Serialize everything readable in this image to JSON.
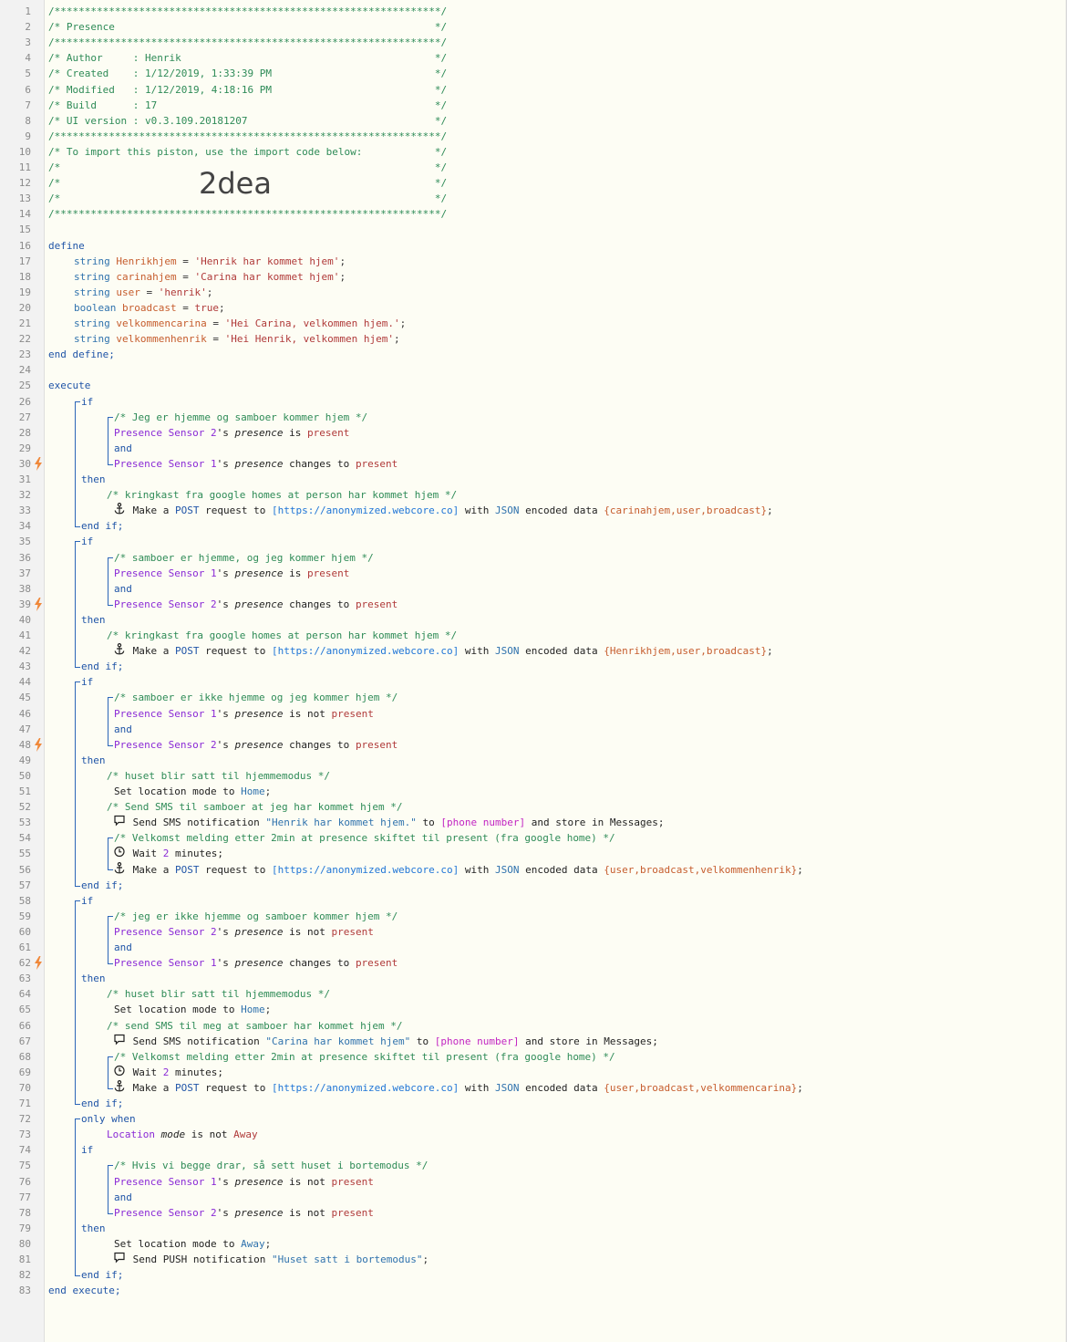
{
  "header_lines": [
    "/****************************************************************/",
    "/* Presence                                                     */",
    "/****************************************************************/",
    "/* Author     : Henrik                                          */",
    "/* Created    : 1/12/2019, 1:33:39 PM                           */",
    "/* Modified   : 1/12/2019, 4:18:16 PM                           */",
    "/* Build      : 17                                              */",
    "/* UI version : v0.3.109.20181207                               */",
    "/****************************************************************/",
    "/* To import this piston, use the import code below:            */",
    "/*                                                              */",
    "/*                                                              */",
    "/*                                                              */",
    "/****************************************************************/"
  ],
  "import_code": "2dea",
  "keywords": {
    "define": "define",
    "end_define": "end define;",
    "execute": "execute",
    "end_execute": "end execute;",
    "if": "if",
    "then": "then",
    "end_if": "end if;",
    "and": "and",
    "only_when": "only when"
  },
  "defines": [
    {
      "type": "string",
      "name": "Henrikhjem",
      "value": "'Henrik har kommet hjem'"
    },
    {
      "type": "string",
      "name": "carinahjem",
      "value": "'Carina har kommet hjem'"
    },
    {
      "type": "string",
      "name": "user",
      "value": "'henrik'"
    },
    {
      "type": "boolean",
      "name": "broadcast",
      "value": "true"
    },
    {
      "type": "string",
      "name": "velkommencarina",
      "value": "'Hei Carina, velkommen hjem.'"
    },
    {
      "type": "string",
      "name": "velkommenhenrik",
      "value": "'Hei Henrik, velkommen hjem'"
    }
  ],
  "texts": {
    "presence_sensor": "Presence Sensor",
    "possessive": "'s",
    "presence": "presence",
    "is": "is",
    "is_not": "is not",
    "changes_to": "changes to",
    "present": "present",
    "make_a": "Make a",
    "post": "POST",
    "request_to": "request to",
    "url": "[https://anonymized.webcore.co]",
    "with": "with",
    "json": "JSON",
    "encoded_data": "encoded data",
    "set_location_mode_to": "Set location mode to",
    "home": "Home",
    "away": "Away",
    "send_sms": "Send SMS notification",
    "to": "to",
    "phone": "[phone number]",
    "store_in": "and store in Messages;",
    "wait": "Wait",
    "minutes": "minutes;",
    "send_push": "Send PUSH notification",
    "location": "Location",
    "mode": "mode",
    "semicolon": ";"
  },
  "comments": {
    "c27": "/* Jeg er hjemme og samboer kommer hjem */",
    "c32": "/* kringkast fra google homes at person har kommet hjem */",
    "c36": "/* samboer er hjemme, og jeg kommer hjem */",
    "c41": "/* kringkast fra google homes at person har kommet hjem */",
    "c45": "/* samboer er ikke hjemme og jeg kommer hjem */",
    "c50": "/* huset blir satt til hjemmemodus */",
    "c52": "/* Send SMS til samboer at jeg har kommet hjem */",
    "c54": "/* Velkomst melding etter 2min at presence skiftet til present (fra google home) */",
    "c59": "/* jeg er ikke hjemme og samboer kommer hjem */",
    "c64": "/* huset blir satt til hjemmemodus */",
    "c66": "/* send SMS til meg at samboer har kommet hjem */",
    "c68": "/* Velkomst melding etter 2min at presence skiftet til present (fra google home) */",
    "c75": "/* Hvis vi begge drar, så sett huset i bortemodus */"
  },
  "data_sets": {
    "d33": "{carinahjem,user,broadcast}",
    "d42": "{Henrikhjem,user,broadcast}",
    "d56": "{user,broadcast,velkommenhenrik}",
    "d70": "{user,broadcast,velkommencarina}"
  },
  "messages": {
    "m53": "\"Henrik har kommet hjem.\"",
    "m67": "\"Carina har kommet hjem\"",
    "m81": "\"Huset satt i bortemodus\""
  },
  "sensor_numbers": {
    "s1": "1",
    "s2": "2"
  },
  "wait_minutes": "2",
  "line_numbers": [
    "1",
    "2",
    "3",
    "4",
    "5",
    "6",
    "7",
    "8",
    "9",
    "10",
    "11",
    "12",
    "13",
    "14",
    "15",
    "16",
    "17",
    "18",
    "19",
    "20",
    "21",
    "22",
    "23",
    "24",
    "25",
    "26",
    "27",
    "28",
    "29",
    "30",
    "31",
    "32",
    "33",
    "34",
    "35",
    "36",
    "37",
    "38",
    "39",
    "40",
    "41",
    "42",
    "43",
    "44",
    "45",
    "46",
    "47",
    "48",
    "49",
    "50",
    "51",
    "52",
    "53",
    "54",
    "55",
    "56",
    "57",
    "58",
    "59",
    "60",
    "61",
    "62",
    "63",
    "64",
    "65",
    "66",
    "67",
    "68",
    "69",
    "70",
    "71",
    "72",
    "73",
    "74",
    "75",
    "76",
    "77",
    "78",
    "79",
    "80",
    "81",
    "82",
    "83"
  ],
  "trigger_lines": [
    "30",
    "39",
    "48",
    "62"
  ],
  "colors": {
    "comment": "#2e8b57",
    "keyword": "#1f54a7",
    "device": "#8a2ad6",
    "value": "#b03a3a",
    "url": "#1f75d6",
    "trigger": "#f0883a"
  }
}
